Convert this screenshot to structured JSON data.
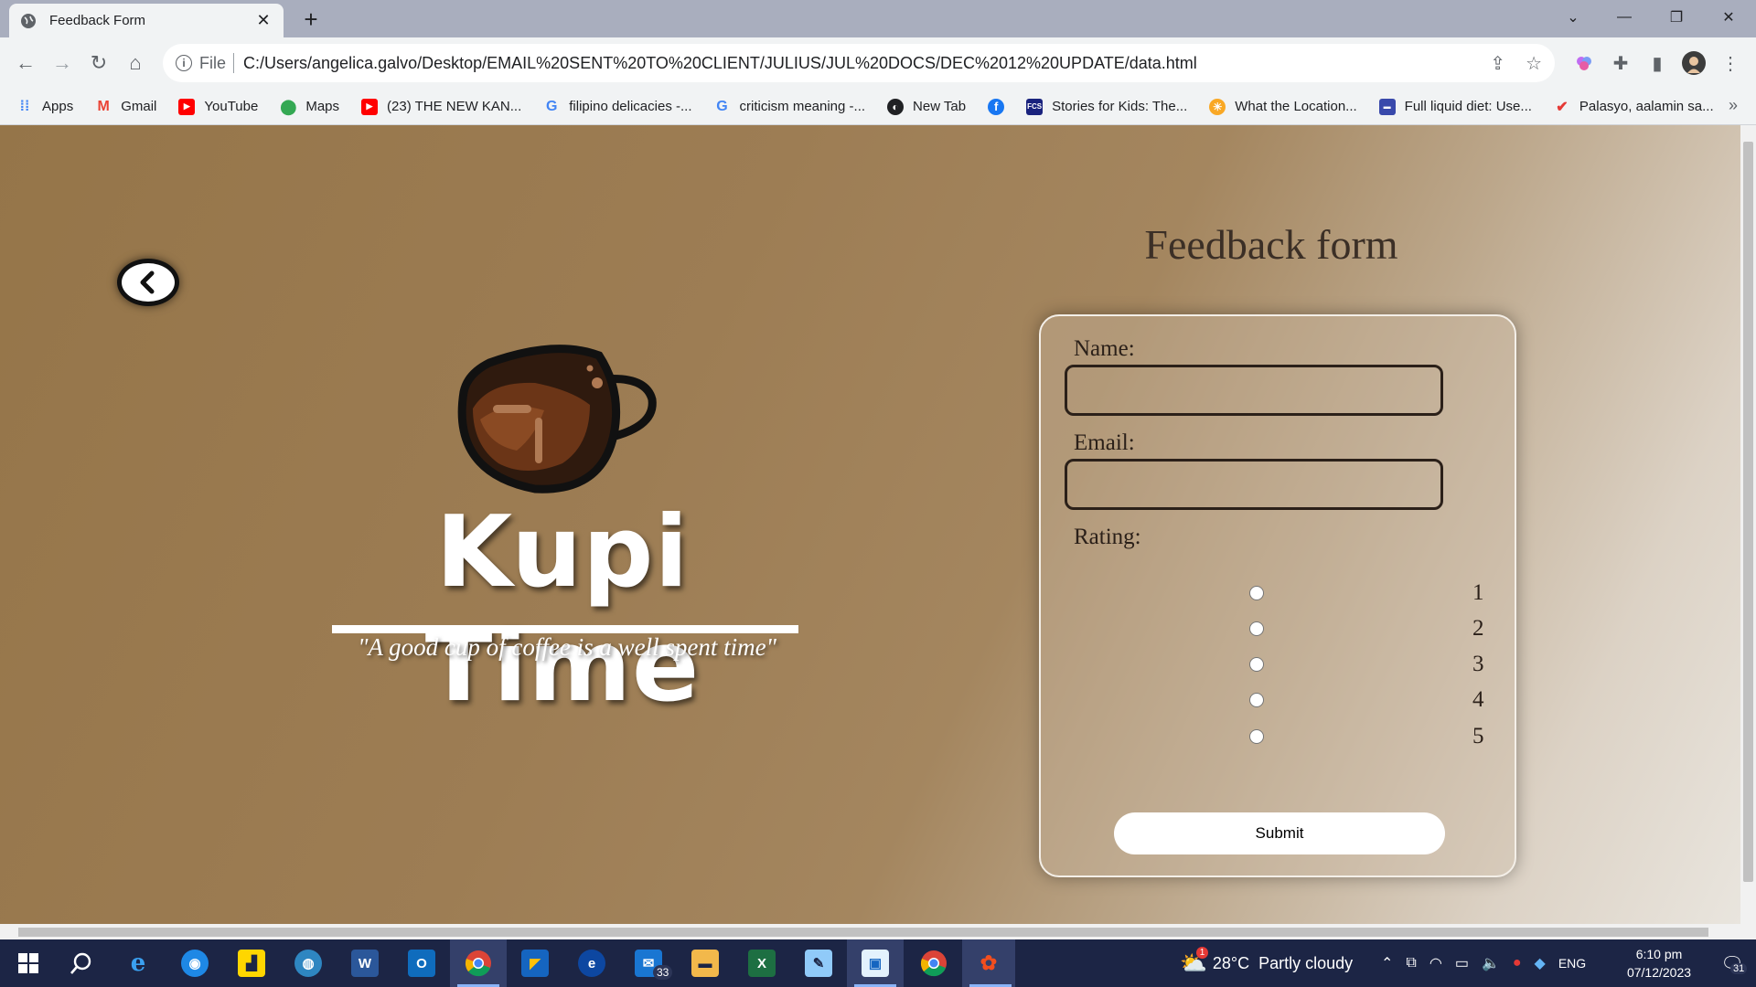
{
  "browser": {
    "tab_title": "Feedback Form",
    "url_scheme": "File",
    "url": "C:/Users/angelica.galvo/Desktop/EMAIL%20SENT%20TO%20CLIENT/JULIUS/JUL%20DOCS/DEC%2012%20UPDATE/data.html",
    "bookmarks": [
      {
        "label": "Apps",
        "icon": "apps-grid-icon",
        "color": "#4285f4"
      },
      {
        "label": "Gmail",
        "icon": "gmail-icon",
        "color": "#ea4335"
      },
      {
        "label": "YouTube",
        "icon": "youtube-icon",
        "color": "#ff0000"
      },
      {
        "label": "Maps",
        "icon": "maps-pin-icon",
        "color": "#34a853"
      },
      {
        "label": "(23) THE NEW KAN...",
        "icon": "youtube-icon",
        "color": "#ff0000"
      },
      {
        "label": "filipino delicacies -...",
        "icon": "google-icon",
        "color": "#4285f4"
      },
      {
        "label": "criticism meaning -...",
        "icon": "google-icon",
        "color": "#4285f4"
      },
      {
        "label": "New Tab",
        "icon": "globe-icon",
        "color": "#202124"
      },
      {
        "label": "",
        "icon": "facebook-icon",
        "color": "#1877f2"
      },
      {
        "label": "Stories for Kids: The...",
        "icon": "fcs-icon",
        "color": "#1a237e"
      },
      {
        "label": "What the Location...",
        "icon": "sun-icon",
        "color": "#f9a825"
      },
      {
        "label": "Full liquid diet: Use...",
        "icon": "site-icon",
        "color": "#3949ab"
      },
      {
        "label": "Palasyo, aalamin sa...",
        "icon": "news-icon",
        "color": "#e53935"
      }
    ]
  },
  "page": {
    "brand_name": "Kupi Time",
    "tagline": "\"A good cup of coffee is a well spent time\"",
    "form_title": "Feedback form",
    "name_label": "Name:",
    "email_label": "Email:",
    "rating_label": "Rating:",
    "rating_options": [
      "1",
      "2",
      "3",
      "4",
      "5"
    ],
    "submit_label": "Submit"
  },
  "taskbar": {
    "mail_badge": "33",
    "weather": "28°C  Partly cloudy",
    "weather_alert": "1",
    "language": "ENG",
    "time": "6:10 pm",
    "date": "07/12/2023",
    "notifications": "31"
  },
  "colors": {
    "tab_strip": "#a9aebe",
    "page_brown": "#9d7d54",
    "taskbar": "#1c2545",
    "text_dark": "#2b2019"
  }
}
